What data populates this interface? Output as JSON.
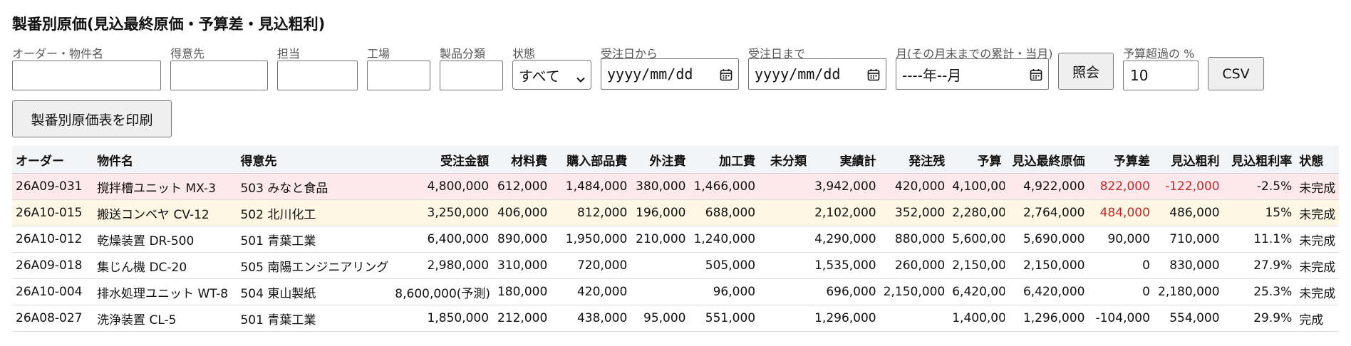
{
  "page": {
    "title": "製番別原価(見込最終原価・予算差・見込粗利)"
  },
  "filters": {
    "order_label": "オーダー・物件名",
    "customer_label": "得意先",
    "person_label": "担当",
    "factory_label": "工場",
    "category_label": "製品分類",
    "status_label": "状態",
    "status_value": "すべて",
    "date_from_label": "受注日から",
    "date_from_placeholder": "yyyy/mm/dd",
    "date_to_label": "受注日まで",
    "date_to_placeholder": "yyyy/mm/dd",
    "month_label": "月(その月末までの累計・当月)",
    "month_placeholder": "----年--月",
    "search_button": "照会",
    "over_label": "予算超過の %",
    "over_value": "10",
    "csv_button": "CSV",
    "print_button": "製番別原価表を印刷"
  },
  "table": {
    "headers": [
      "オーダー",
      "物件名",
      "得意先",
      "受注金額",
      "材料費",
      "購入部品費",
      "外注費",
      "加工費",
      "未分類",
      "実績計",
      "発注残",
      "予算",
      "見込最終原価",
      "予算差",
      "見込粗利",
      "見込粗利率",
      "状態"
    ],
    "rows": [
      [
        "26A09-031",
        "撹拌槽ユニット MX-3",
        "503 みなと食品",
        "4,800,000",
        "612,000",
        "1,484,000",
        "380,000",
        "1,466,000",
        "",
        "3,942,000",
        "420,000",
        "4,100,000",
        "4,922,000",
        "822,000",
        "-122,000",
        "-2.5%",
        "未完成"
      ],
      [
        "26A10-015",
        "搬送コンベヤ CV-12",
        "502 北川化工",
        "3,250,000",
        "406,000",
        "812,000",
        "196,000",
        "688,000",
        "",
        "2,102,000",
        "352,000",
        "2,280,000",
        "2,764,000",
        "484,000",
        "486,000",
        "15%",
        "未完成"
      ],
      [
        "26A10-012",
        "乾燥装置 DR-500",
        "501 青葉工業",
        "6,400,000",
        "890,000",
        "1,950,000",
        "210,000",
        "1,240,000",
        "",
        "4,290,000",
        "880,000",
        "5,600,000",
        "5,690,000",
        "90,000",
        "710,000",
        "11.1%",
        "未完成"
      ],
      [
        "26A09-018",
        "集じん機 DC-20",
        "505 南陽エンジニアリング",
        "2,980,000",
        "310,000",
        "720,000",
        "",
        "505,000",
        "",
        "1,535,000",
        "260,000",
        "2,150,000",
        "2,150,000",
        "0",
        "830,000",
        "27.9%",
        "未完成"
      ],
      [
        "26A10-004",
        "排水処理ユニット WT-8",
        "504 東山製紙",
        "8,600,000(予測)",
        "180,000",
        "420,000",
        "",
        "96,000",
        "",
        "696,000",
        "2,150,000",
        "6,420,000",
        "6,420,000",
        "0",
        "2,180,000",
        "25.3%",
        "未完成"
      ],
      [
        "26A08-027",
        "洗浄装置 CL-5",
        "501 青葉工業",
        "1,850,000",
        "212,000",
        "438,000",
        "95,000",
        "551,000",
        "",
        "1,296,000",
        "",
        "1,400,000",
        "1,296,000",
        "-104,000",
        "554,000",
        "29.9%",
        "完成"
      ]
    ]
  },
  "colors": {
    "over_budget_row": "#fde9ec",
    "warning_row": "#fdf7e3",
    "negative_text": "#c62828",
    "header_bg": "#f3f4f6"
  }
}
